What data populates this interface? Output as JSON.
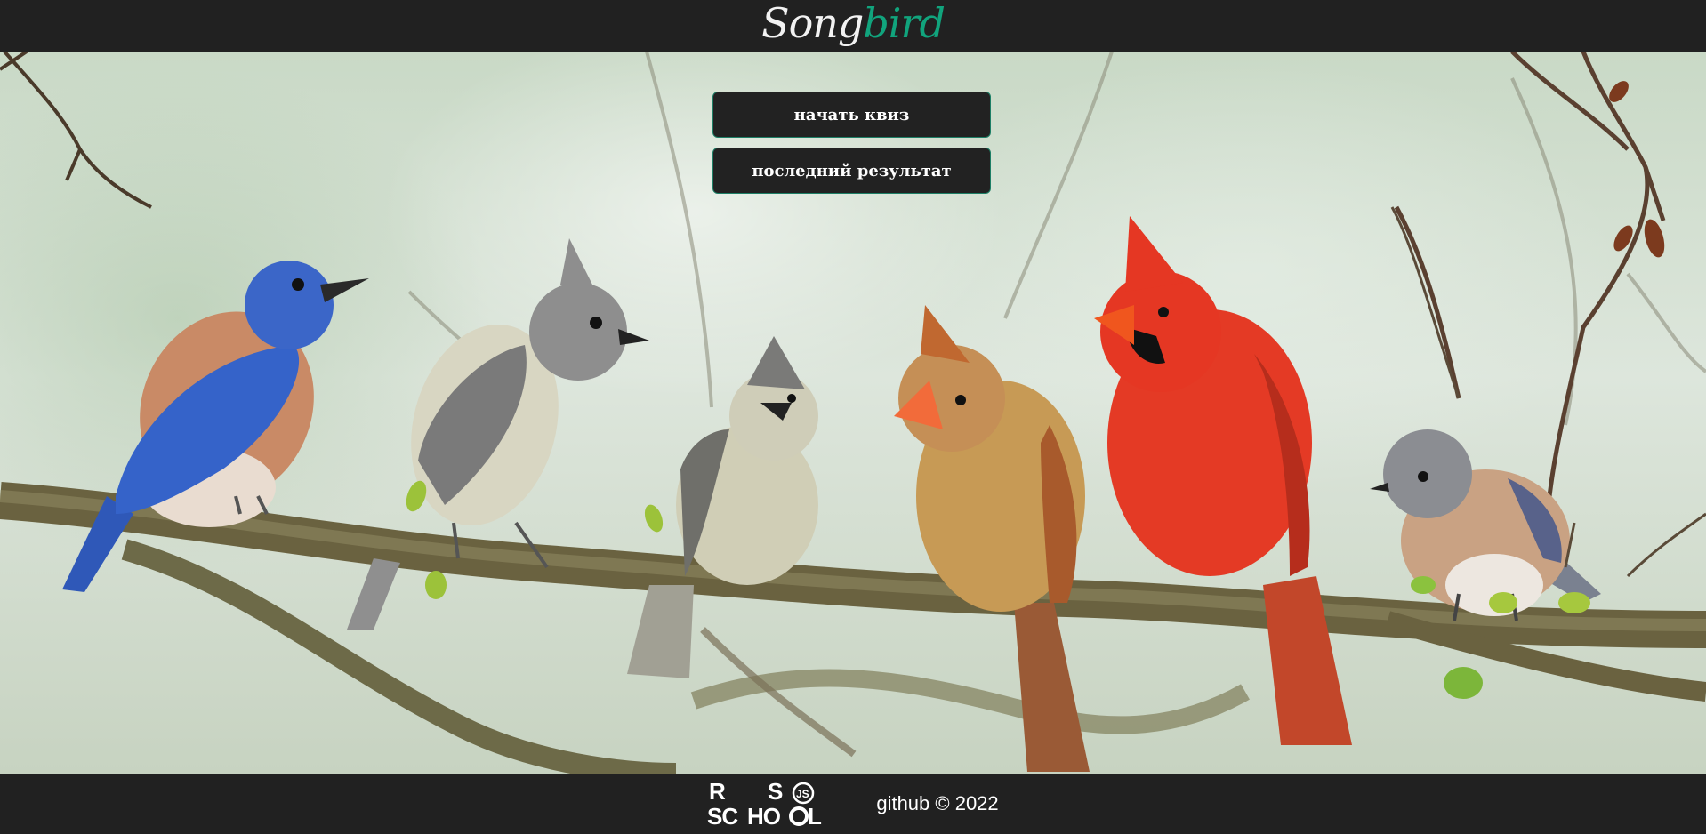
{
  "header": {
    "logo_part1": "Song",
    "logo_part2": "bird"
  },
  "menu": {
    "start_quiz": "начать квиз",
    "last_result": "последний результат"
  },
  "hero": {
    "birds": [
      "eastern-bluebird",
      "tufted-titmouse",
      "tufted-titmouse-small",
      "female-cardinal",
      "male-cardinal",
      "female-bluebird"
    ]
  },
  "footer": {
    "school_logo": "RS SCHOOL JS",
    "copyright": "github © 2022"
  },
  "colors": {
    "header_bg": "#212121",
    "accent": "#11a47d",
    "button_bg": "#222222",
    "button_border": "#1d7f66"
  }
}
